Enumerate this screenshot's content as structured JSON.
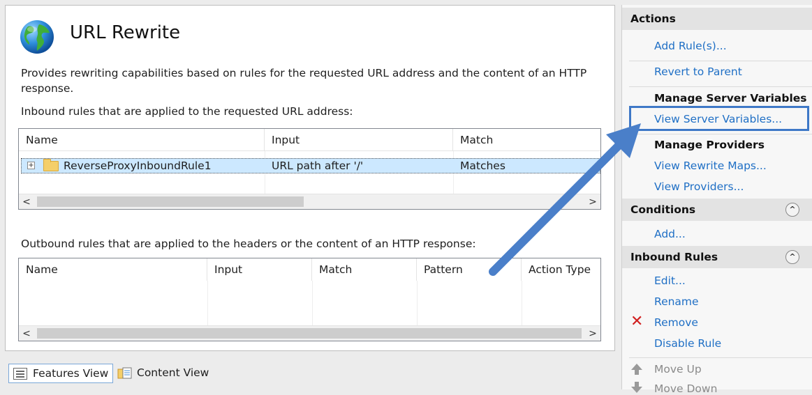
{
  "main": {
    "title": "URL Rewrite",
    "description": "Provides rewriting capabilities based on rules for the requested URL address and the content of an HTTP response.",
    "inbound": {
      "label": "Inbound rules that are applied to the requested URL address:",
      "columns": [
        "Name",
        "Input",
        "Match"
      ],
      "rows": [
        {
          "name": "ReverseProxyInboundRule1",
          "input": "URL path after '/'",
          "match": "Matches"
        }
      ]
    },
    "outbound": {
      "label": "Outbound rules that are applied to the headers or the content of an HTTP response:",
      "columns": [
        "Name",
        "Input",
        "Match",
        "Pattern",
        "Action Type"
      ]
    }
  },
  "tabs": {
    "features": "Features View",
    "content": "Content View"
  },
  "actions": {
    "header": "Actions",
    "add_rules": "Add Rule(s)...",
    "revert": "Revert to Parent",
    "manage_server_vars": "Manage Server Variables",
    "view_server_vars": "View Server Variables...",
    "manage_providers": "Manage Providers",
    "view_rewrite_maps": "View Rewrite Maps...",
    "view_providers": "View Providers...",
    "conditions_header": "Conditions",
    "conditions_add": "Add...",
    "inbound_header": "Inbound Rules",
    "edit": "Edit...",
    "rename": "Rename",
    "remove": "Remove",
    "disable_rule": "Disable Rule",
    "move_up": "Move Up",
    "move_down": "Move Down"
  },
  "icons": {
    "globe": "globe-icon",
    "folder": "folder-icon",
    "expand": "plus-box-icon",
    "remove": "red-x-icon",
    "move_up": "arrow-up-icon",
    "collapse": "chevron-up-circle-icon"
  },
  "colors": {
    "link": "#1f6fc5",
    "selection": "#cce8ff",
    "annotation": "#3e78c7",
    "remove": "#d11f1f"
  }
}
